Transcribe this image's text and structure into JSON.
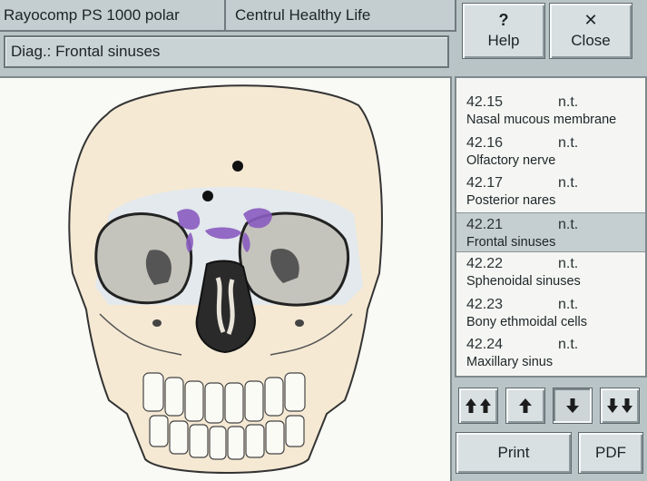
{
  "header": {
    "app_title": "Rayocomp PS 1000 polar",
    "patient_name": "Centrul Healthy Life"
  },
  "buttons": {
    "help": {
      "glyph": "?",
      "label": "Help"
    },
    "close": {
      "glyph": "✕",
      "label": "Close"
    },
    "print": "Print",
    "pdf": "PDF"
  },
  "diagnosis": {
    "label": "Diag.: Frontal sinuses"
  },
  "list": {
    "selected_index": 3,
    "items": [
      {
        "code": "42.15",
        "status": "n.t.",
        "name": "Nasal mucous membrane"
      },
      {
        "code": "42.16",
        "status": "n.t.",
        "name": "Olfactory nerve"
      },
      {
        "code": "42.17",
        "status": "n.t.",
        "name": "Posterior nares"
      },
      {
        "code": "42.21",
        "status": "n.t.",
        "name": "Frontal sinuses"
      },
      {
        "code": "42.22",
        "status": "n.t.",
        "name": "Sphenoidal sinuses"
      },
      {
        "code": "42.23",
        "status": "n.t.",
        "name": "Bony ethmoidal cells"
      },
      {
        "code": "42.24",
        "status": "n.t.",
        "name": "Maxillary sinus"
      }
    ]
  },
  "nav_icons": [
    "double-arrow-up-icon",
    "arrow-up-icon",
    "arrow-down-icon",
    "double-arrow-down-icon"
  ],
  "colors": {
    "highlight_sinus": "#8a5cc0",
    "selected_row": "#c5ced0",
    "marker_dot": "#111111"
  }
}
